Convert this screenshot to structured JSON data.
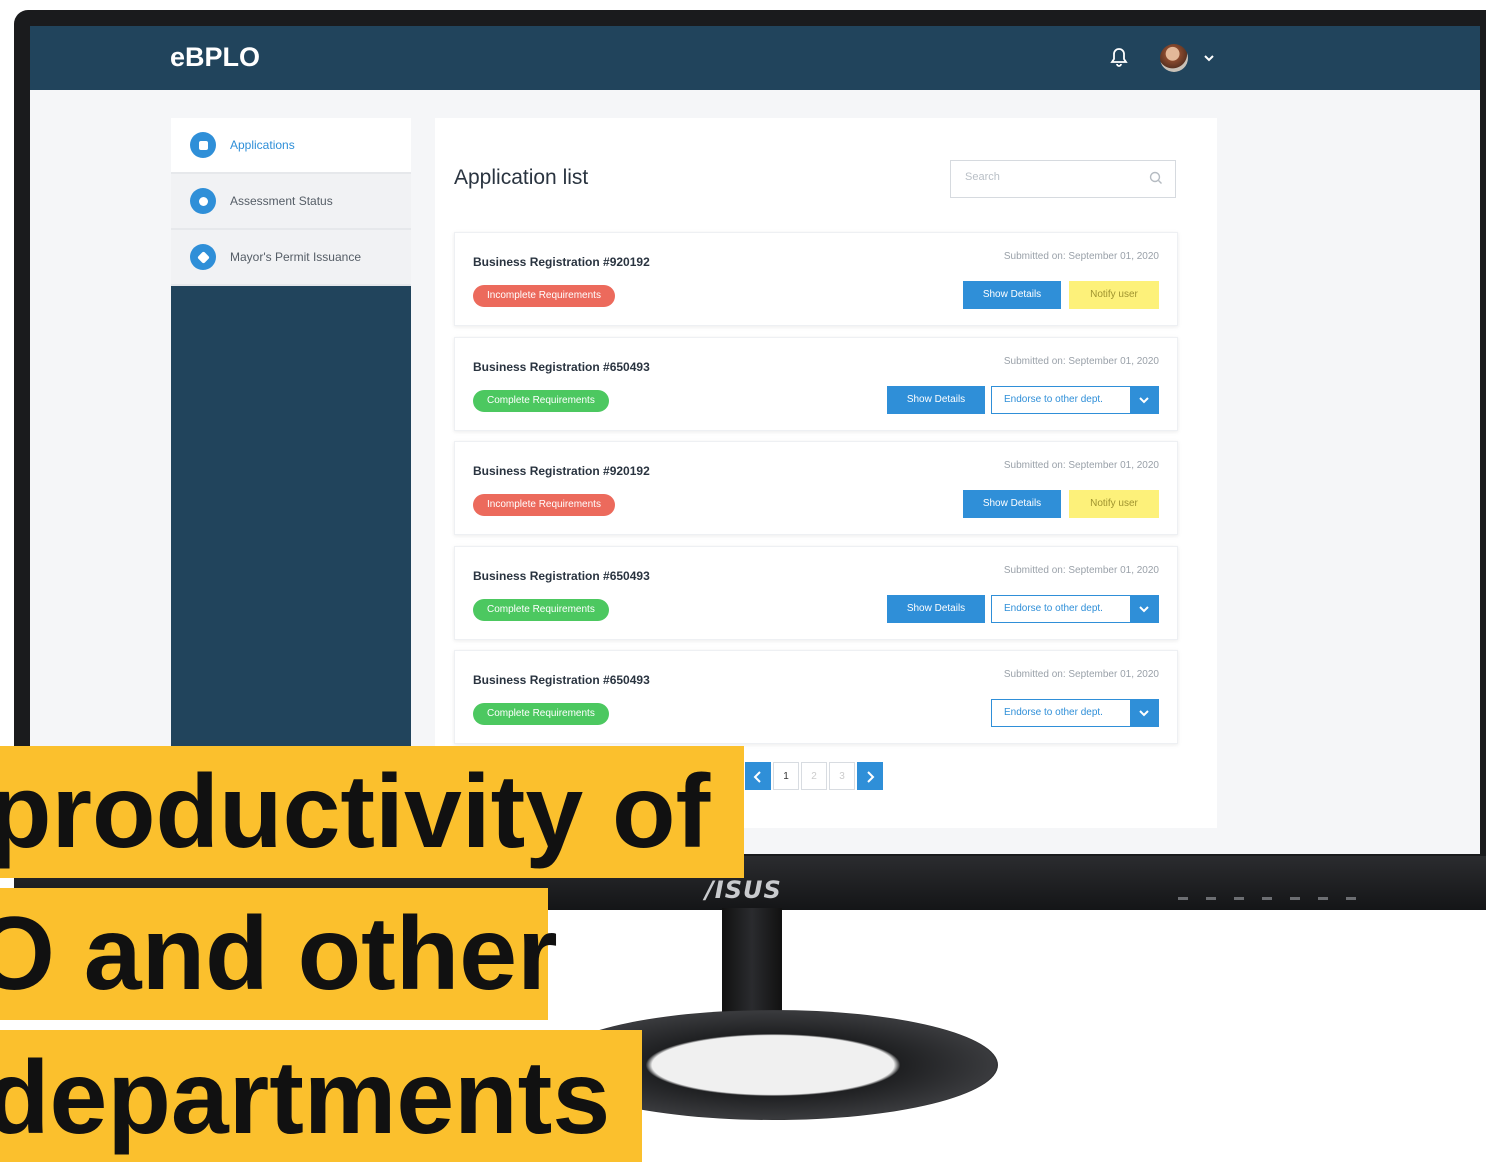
{
  "app": {
    "title": "eBPLO"
  },
  "header": {
    "notification_icon": "bell-icon",
    "avatar_icon": "avatar",
    "menu_icon": "chevron-down-icon"
  },
  "sidebar": {
    "items": [
      {
        "label": "Applications",
        "icon": "document-icon",
        "active": true
      },
      {
        "label": "Assessment Status",
        "icon": "clock-icon",
        "active": false
      },
      {
        "label": "Mayor's Permit Issuance",
        "icon": "star-icon",
        "active": false
      }
    ]
  },
  "main": {
    "title": "Application list",
    "search": {
      "placeholder": "Search"
    },
    "cards": [
      {
        "title": "Business Registration #920192",
        "status": "Incomplete Requirements",
        "submitted": "Submitted on: September 01, 2020",
        "show_details": "Show Details",
        "action": "Notify user"
      },
      {
        "title": "Business Registration #650493",
        "status": "Complete Requirements",
        "submitted": "Submitted on: September 01, 2020",
        "show_details": "Show Details",
        "action": "Endorse to other dept."
      },
      {
        "title": "Business Registration #920192",
        "status": "Incomplete Requirements",
        "submitted": "Submitted on: September 01, 2020",
        "show_details": "Show Details",
        "action": "Notify user"
      },
      {
        "title": "Business Registration #650493",
        "status": "Complete Requirements",
        "submitted": "Submitted on: September 01, 2020",
        "show_details": "Show Details",
        "action": "Endorse to other dept."
      },
      {
        "title": "Business Registration #650493",
        "status": "Complete Requirements",
        "submitted": "Submitted on: September 01, 2020",
        "action": "Endorse to other dept."
      }
    ],
    "pagination": {
      "pages": [
        "1",
        "2",
        "3"
      ],
      "current": "1"
    }
  },
  "monitor": {
    "brand": "/ISUS"
  },
  "caption": {
    "line1": "productivity of",
    "line2": "O and other",
    "line3": "departments"
  },
  "colors": {
    "header": "#21445c",
    "accent": "#2f8fd8",
    "incomplete": "#ec6a5c",
    "complete": "#4cc860",
    "notify": "#fdf17a",
    "caption_bg": "#fbc02d"
  }
}
